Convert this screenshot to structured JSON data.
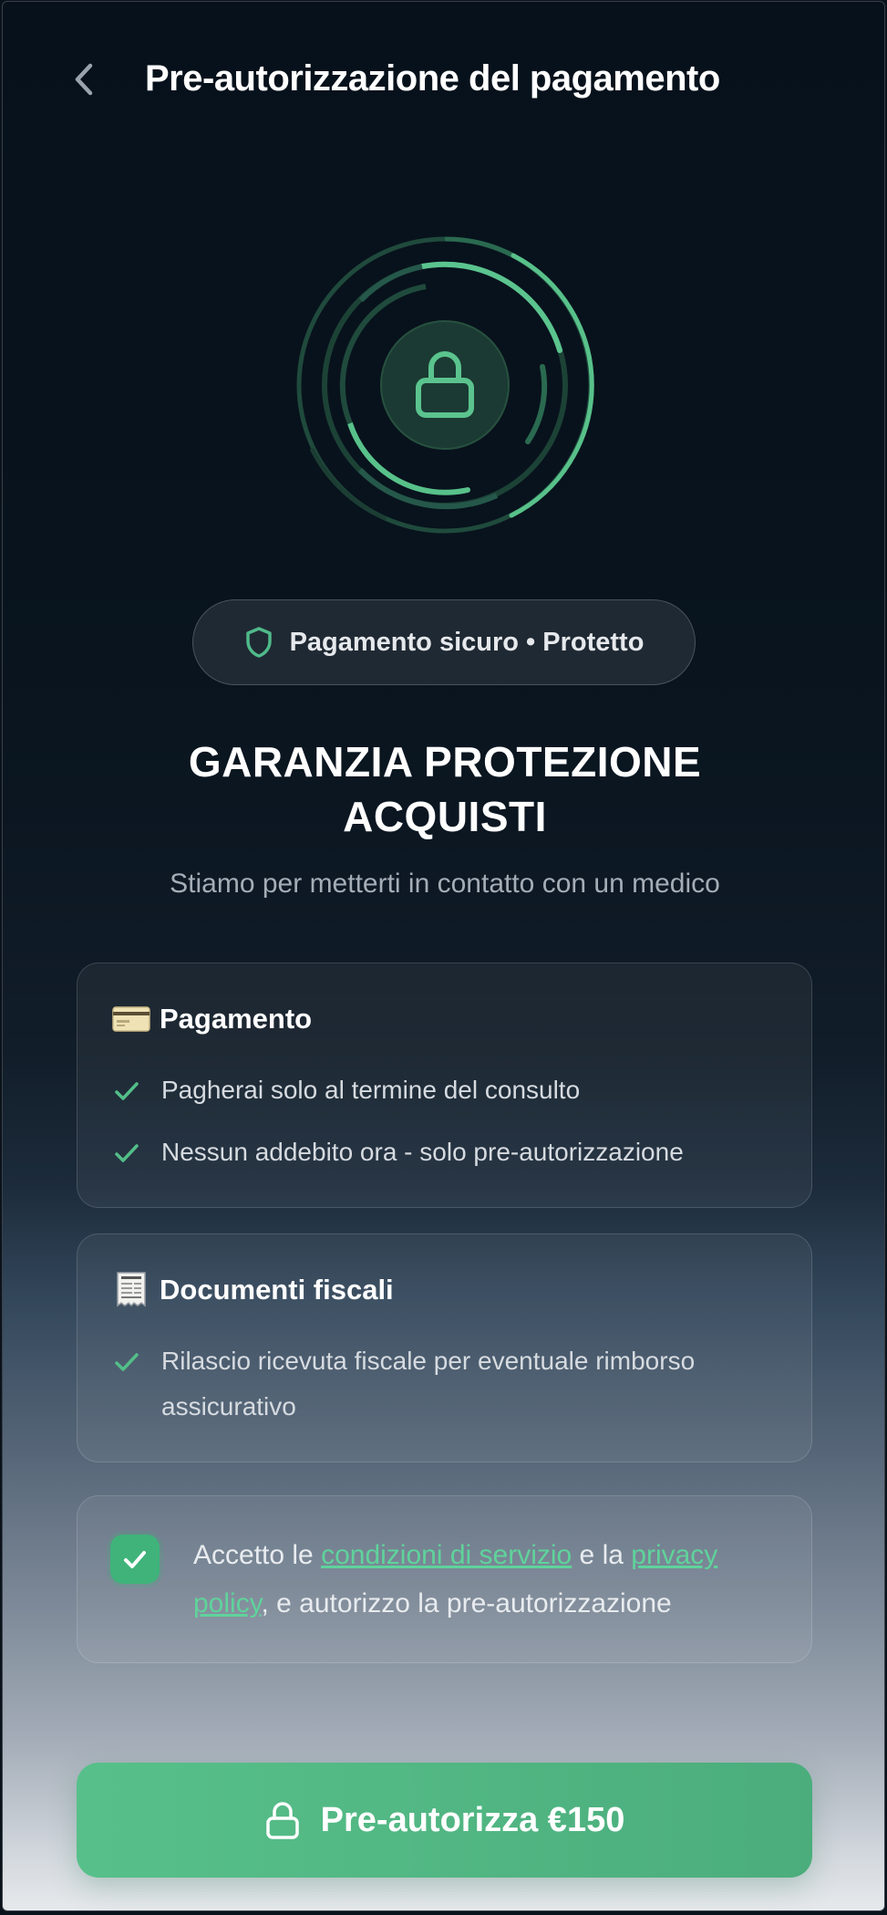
{
  "header": {
    "title": "Pre-autorizzazione del pagamento"
  },
  "badge": {
    "label": "Pagamento sicuro • Protetto"
  },
  "headline": "GARANZIA PROTEZIONE ACQUISTI",
  "subtitle": "Stiamo per metterti in contatto con un medico",
  "payment_card": {
    "title": "Pagamento",
    "icon": "credit-card-emoji",
    "items": [
      "Pagherai solo al termine del consulto",
      "Nessun addebito ora - solo pre-autorizzazione"
    ]
  },
  "fiscal_card": {
    "title": "Documenti fiscali",
    "icon": "receipt-emoji",
    "items": [
      "Rilascio ricevuta fiscale per eventuale rimborso assicurativo"
    ]
  },
  "consent": {
    "checked": true,
    "prefix": "Accetto le ",
    "terms_link": "condizioni di servizio",
    "middle": " e la ",
    "privacy_link": "privacy policy",
    "suffix": ", e autorizzo la pre-autorizzazione"
  },
  "cta": {
    "label": "Pre-autorizza €150",
    "icon": "lock-icon"
  },
  "colors": {
    "accent": "#57c08a",
    "link": "#5fd39b",
    "background_top": "#07111b",
    "background_bottom": "#e6e9ec"
  }
}
